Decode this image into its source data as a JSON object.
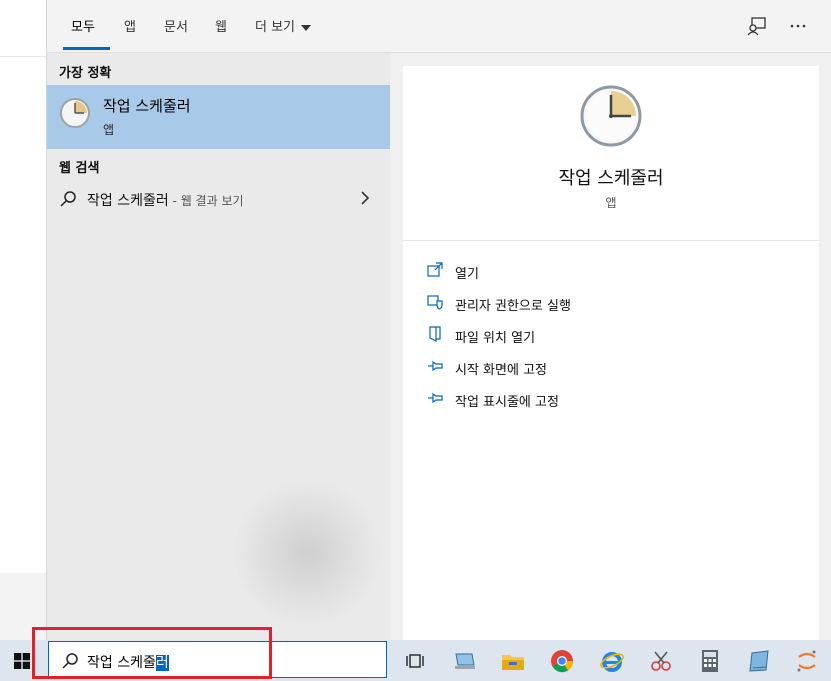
{
  "tabs": [
    {
      "label": "모두",
      "active": true
    },
    {
      "label": "앱"
    },
    {
      "label": "문서"
    },
    {
      "label": "웹"
    },
    {
      "label": "더 보기"
    }
  ],
  "best_match": {
    "section_label": "가장 정확",
    "title": "작업 스케줄러",
    "subtitle": "앱"
  },
  "web_search": {
    "section_label": "웹 검색",
    "query": "작업 스케줄러",
    "hint": " - 웹 결과 보기"
  },
  "detail": {
    "title": "작업 스케줄러",
    "subtitle": "앱",
    "actions": [
      {
        "label": "열기",
        "icon": "open-icon"
      },
      {
        "label": "관리자 권한으로 실행",
        "icon": "shield-icon"
      },
      {
        "label": "파일 위치 열기",
        "icon": "file-location-icon"
      },
      {
        "label": "시작 화면에 고정",
        "icon": "pin-icon"
      },
      {
        "label": "작업 표시줄에 고정",
        "icon": "pin-icon"
      }
    ]
  },
  "taskbar": {
    "search_text_plain": "작업 스케줄",
    "search_text_selected": "러",
    "apps": [
      "task-view-icon",
      "computer-icon",
      "file-explorer-icon",
      "chrome-icon",
      "internet-explorer-icon",
      "snipping-tool-icon",
      "calculator-icon",
      "notepad-icon",
      "jupyter-icon"
    ]
  },
  "colors": {
    "accent": "#0067c0",
    "highlight": "#a9c9e8",
    "annotation": "#e2202b"
  }
}
